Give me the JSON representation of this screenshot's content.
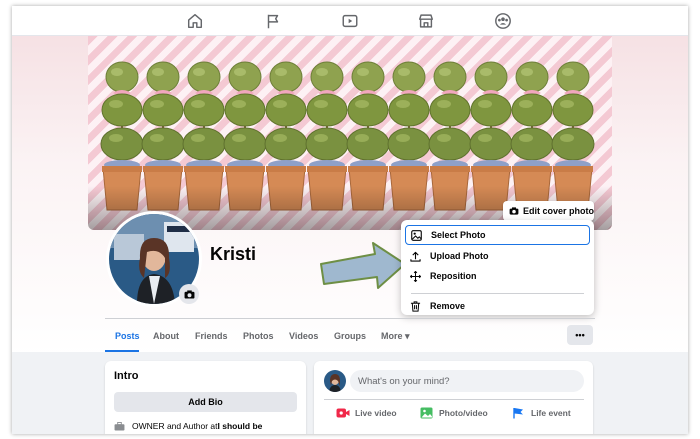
{
  "topnav": {
    "icons": [
      "home-icon",
      "flag-icon",
      "video-icon",
      "marketplace-icon",
      "groups-icon"
    ]
  },
  "cover": {
    "edit_label": "Edit cover photo"
  },
  "profile": {
    "name": "Kristi"
  },
  "cover_menu": {
    "items": [
      {
        "label": "Select Photo",
        "icon": "select-photo-icon",
        "selected": true
      },
      {
        "label": "Upload Photo",
        "icon": "upload-icon"
      },
      {
        "label": "Reposition",
        "icon": "move-icon"
      },
      {
        "label": "Remove",
        "icon": "trash-icon"
      }
    ]
  },
  "tabs": {
    "items": [
      "Posts",
      "About",
      "Friends",
      "Photos",
      "Videos",
      "Groups",
      "More ▾"
    ],
    "active": "Posts",
    "more_button": "•••"
  },
  "intro": {
    "title": "Intro",
    "add_bio": "Add Bio",
    "line_prefix": "OWNER and Author at ",
    "line_bold": "I should be"
  },
  "composer": {
    "placeholder": "What's on your mind?",
    "actions": [
      {
        "label": "Live video",
        "icon": "live-video-icon",
        "color": "#f02849"
      },
      {
        "label": "Photo/video",
        "icon": "photo-video-icon",
        "color": "#45bd62"
      },
      {
        "label": "Life event",
        "icon": "life-event-icon",
        "color": "#1877f2"
      }
    ]
  },
  "colors": {
    "accent": "#1b74e4",
    "arrow_fill": "#9fb8cf",
    "arrow_stroke": "#6e8f45"
  }
}
